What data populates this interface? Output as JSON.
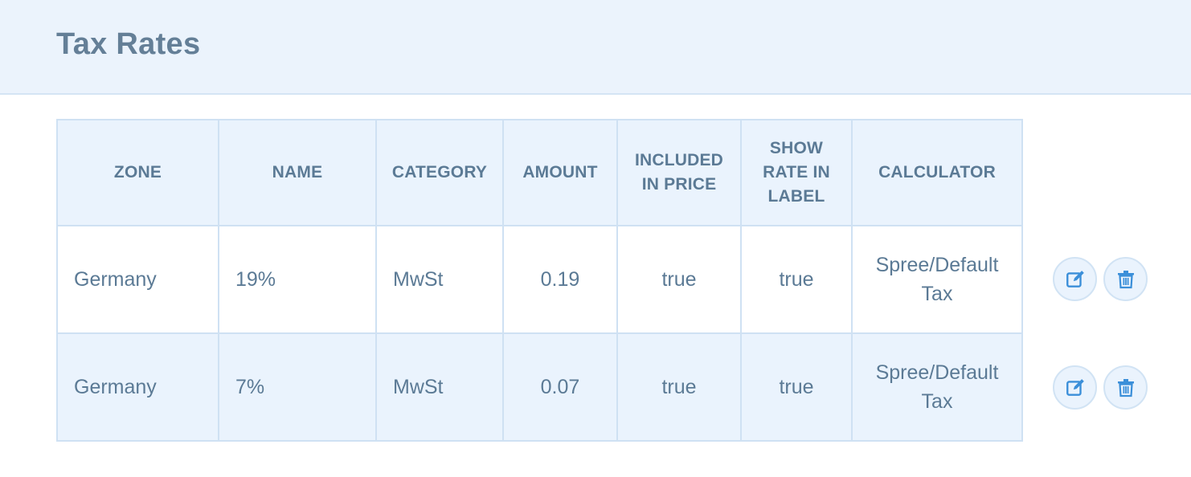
{
  "header": {
    "title": "Tax Rates"
  },
  "table": {
    "columns": [
      {
        "key": "zone",
        "label": "ZONE"
      },
      {
        "key": "name",
        "label": "NAME"
      },
      {
        "key": "category",
        "label": "CATEGORY"
      },
      {
        "key": "amount",
        "label": "AMOUNT"
      },
      {
        "key": "included_in_price",
        "label": "INCLUDED IN PRICE"
      },
      {
        "key": "show_rate_in_label",
        "label": "SHOW RATE IN LABEL"
      },
      {
        "key": "calculator",
        "label": "CALCULATOR"
      }
    ],
    "rows": [
      {
        "zone": "Germany",
        "name": "19%",
        "category": "MwSt",
        "amount": "0.19",
        "included_in_price": "true",
        "show_rate_in_label": "true",
        "calculator": "Spree/Default Tax"
      },
      {
        "zone": "Germany",
        "name": "7%",
        "category": "MwSt",
        "amount": "0.07",
        "included_in_price": "true",
        "show_rate_in_label": "true",
        "calculator": "Spree/Default Tax"
      }
    ]
  },
  "actions": {
    "edit_icon": "edit-icon",
    "delete_icon": "trash-icon"
  },
  "colors": {
    "header_bg": "#ebf3fc",
    "border": "#cfe1f3",
    "text": "#5b7a95",
    "icon_blue": "#3b8fd9"
  }
}
